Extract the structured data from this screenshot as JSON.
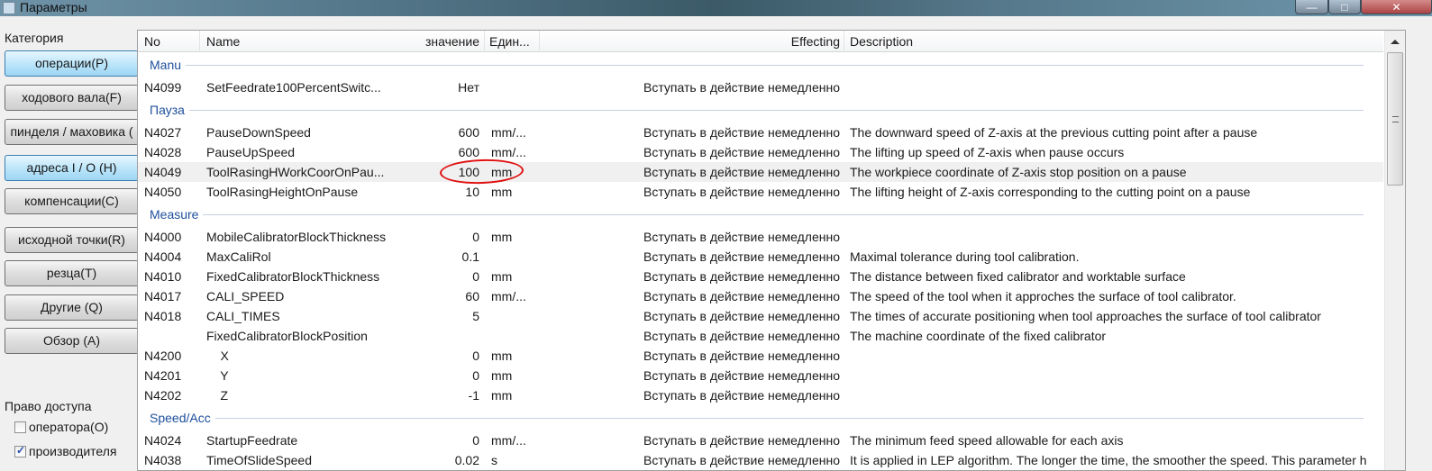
{
  "window": {
    "title": "Параметры",
    "minimize": "—",
    "maximize": "□",
    "close": "✕"
  },
  "sidebar": {
    "category_label": "Категория",
    "buttons": [
      {
        "label": "операции(P)",
        "active": true
      },
      {
        "label": "ходового вала(F)",
        "active": false
      },
      {
        "label": "пинделя / маховика (",
        "active": false
      },
      {
        "label": "адреса I / O (H)",
        "active": true
      },
      {
        "label": "компенсации(C)",
        "active": false
      },
      {
        "label": "исходной точки(R)",
        "active": false
      },
      {
        "label": "резца(T)",
        "active": false
      },
      {
        "label": "Другие  (Q)",
        "active": false
      },
      {
        "label": "Обзор  (A)",
        "active": false
      }
    ],
    "access_label": "Право доступа",
    "access": [
      {
        "label": "оператора(O)",
        "checked": false
      },
      {
        "label": "производителя",
        "checked": true
      }
    ]
  },
  "table": {
    "columns": {
      "no": "No",
      "name": "Name",
      "value": "значение",
      "unit": "Един...",
      "effecting": "Effecting",
      "description": "Description"
    },
    "highlight_color": "#e01010",
    "items": [
      {
        "group": "Manu"
      },
      {
        "no": "N4099",
        "name": "SetFeedrate100PercentSwitc...",
        "value": "Нет",
        "unit": "",
        "eff": "Вступать в действие немедленно",
        "desc": ""
      },
      {
        "group": "Пауза"
      },
      {
        "no": "N4027",
        "name": "PauseDownSpeed",
        "value": "600",
        "unit": "mm/...",
        "eff": "Вступать в действие немедленно",
        "desc": "The downward speed of Z-axis at the previous cutting point after a pause"
      },
      {
        "no": "N4028",
        "name": "PauseUpSpeed",
        "value": "600",
        "unit": "mm/...",
        "eff": "Вступать в действие немедленно",
        "desc": "The lifting up speed of Z-axis when pause occurs"
      },
      {
        "no": "N4049",
        "name": "ToolRasingHWorkCoorOnPau...",
        "value": "100",
        "unit": "mm",
        "eff": "Вступать в действие немедленно",
        "desc": "The workpiece coordinate of Z-axis stop position on a pause",
        "selected": true,
        "circled": true
      },
      {
        "no": "N4050",
        "name": "ToolRasingHeightOnPause",
        "value": "10",
        "unit": "mm",
        "eff": "Вступать в действие немедленно",
        "desc": "The lifting height of Z-axis corresponding to the cutting point on a pause"
      },
      {
        "group": "Measure"
      },
      {
        "no": "N4000",
        "name": "MobileCalibratorBlockThickness",
        "value": "0",
        "unit": "mm",
        "eff": "Вступать в действие немедленно",
        "desc": ""
      },
      {
        "no": "N4004",
        "name": "MaxCaliRol",
        "value": "0.1",
        "unit": "",
        "eff": "Вступать в действие немедленно",
        "desc": "Maximal tolerance during tool calibration."
      },
      {
        "no": "N4010",
        "name": "FixedCalibratorBlockThickness",
        "value": "0",
        "unit": "mm",
        "eff": "Вступать в действие немедленно",
        "desc": "The distance between fixed calibrator and worktable surface"
      },
      {
        "no": "N4017",
        "name": "CALI_SPEED",
        "value": "60",
        "unit": "mm/...",
        "eff": "Вступать в действие немедленно",
        "desc": "The speed of the tool when it approches the surface of tool calibrator."
      },
      {
        "no": "N4018",
        "name": "CALI_TIMES",
        "value": "5",
        "unit": "",
        "eff": "Вступать в действие немедленно",
        "desc": "The times of accurate positioning when tool approaches the surface of tool calibrator"
      },
      {
        "no": "",
        "name": "FixedCalibratorBlockPosition",
        "value": "",
        "unit": "",
        "eff": "Вступать в действие немедленно",
        "desc": "The machine coordinate of the fixed calibrator"
      },
      {
        "no": "N4200",
        "name": "    X",
        "value": "0",
        "unit": "mm",
        "eff": "Вступать в действие немедленно",
        "desc": ""
      },
      {
        "no": "N4201",
        "name": "    Y",
        "value": "0",
        "unit": "mm",
        "eff": "Вступать в действие немедленно",
        "desc": ""
      },
      {
        "no": "N4202",
        "name": "    Z",
        "value": "-1",
        "unit": "mm",
        "eff": "Вступать в действие немедленно",
        "desc": ""
      },
      {
        "group": "Speed/Acc"
      },
      {
        "no": "N4024",
        "name": "StartupFeedrate",
        "value": "0",
        "unit": "mm/...",
        "eff": "Вступать в действие немедленно",
        "desc": "The minimum feed speed allowable for each axis"
      },
      {
        "no": "N4038",
        "name": "TimeOfSlideSpeed",
        "value": "0.02",
        "unit": "s",
        "eff": "Вступать в действие немедленно",
        "desc": "It is applied in LEP algorithm. The longer the time, the smoother the speed. This parameter h"
      }
    ]
  }
}
